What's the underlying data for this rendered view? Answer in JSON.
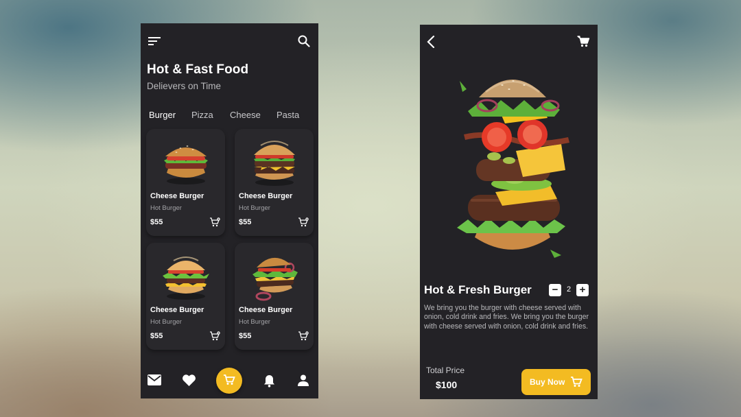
{
  "home": {
    "title": "Hot & Fast Food",
    "subtitle": "Delievers on Time",
    "categories": [
      {
        "label": "Burger",
        "active": true
      },
      {
        "label": "Pizza",
        "active": false
      },
      {
        "label": "Cheese",
        "active": false
      },
      {
        "label": "Pasta",
        "active": false
      }
    ],
    "products": [
      {
        "name": "Cheese Burger",
        "sub": "Hot Burger",
        "price": "$55"
      },
      {
        "name": "Cheese Burger",
        "sub": "Hot Burger",
        "price": "$55"
      },
      {
        "name": "Cheese Burger",
        "sub": "Hot Burger",
        "price": "$55"
      },
      {
        "name": "Cheese Burger",
        "sub": "Hot Burger",
        "price": "$55"
      }
    ],
    "nav": [
      "mail-icon",
      "heart-icon",
      "cart-icon",
      "bell-icon",
      "user-icon"
    ]
  },
  "detail": {
    "title": "Hot & Fresh Burger",
    "quantity": "2",
    "minus": "−",
    "plus": "+",
    "description": "We bring you the burger with cheese served with onion, cold drink and fries. We bring you the burger with cheese served with onion, cold drink and fries.",
    "total_label": "Total Price",
    "total_value": "$100",
    "buy_label": "Buy Now"
  },
  "colors": {
    "accent": "#f3bb22",
    "panel": "#232226",
    "card": "#29282c"
  }
}
